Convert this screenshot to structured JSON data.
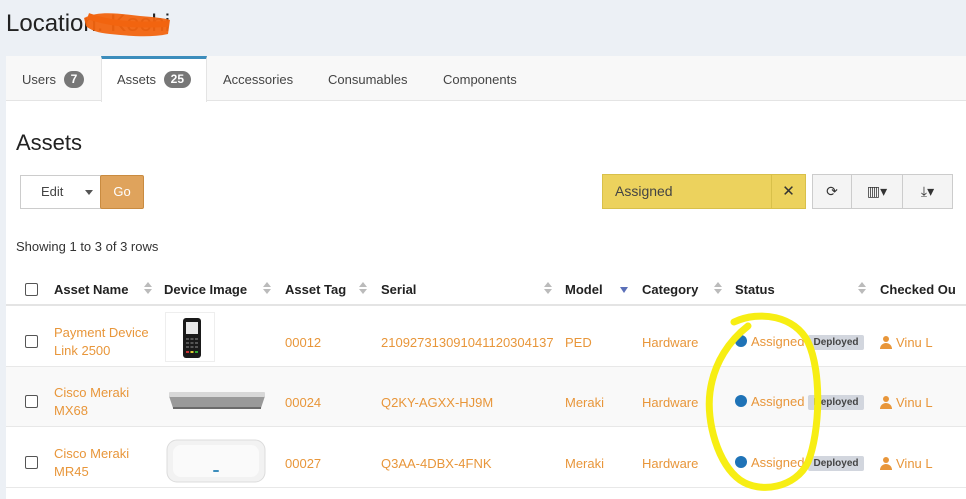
{
  "header": {
    "title": "Location: Kochi"
  },
  "tabs": [
    {
      "label": "Users",
      "count": "7"
    },
    {
      "label": "Assets",
      "count": "25"
    },
    {
      "label": "Accessories"
    },
    {
      "label": "Consumables"
    },
    {
      "label": "Components"
    }
  ],
  "section": {
    "title": "Assets"
  },
  "toolbar": {
    "bulk_action": "Edit",
    "go_label": "Go",
    "search_value": "Assigned",
    "clear_glyph": "✕",
    "refresh_glyph": "⟳",
    "columns_glyph": "▥▾",
    "export_glyph": "⤓▾"
  },
  "table": {
    "info": "Showing 1 to 3 of 3 rows",
    "columns": [
      "Asset Name",
      "Device Image",
      "Asset Tag",
      "Serial",
      "Model",
      "Category",
      "Status",
      "Checked Ou"
    ],
    "rows": [
      {
        "name": "Payment Device Link 2500",
        "tag": "00012",
        "serial": "2109273130910411203041​37",
        "model": "PED",
        "category": "Hardware",
        "status": "Assigned",
        "status_badge": "Deployed",
        "checked_out": "Vinu L",
        "image": "payment-terminal-icon"
      },
      {
        "name": "Cisco Meraki MX68",
        "tag": "00024",
        "serial": "Q2KY-AGXX-HJ9M",
        "model": "Meraki",
        "category": "Hardware",
        "status": "Assigned",
        "status_badge": "Deployed",
        "checked_out": "Vinu L",
        "image": "router-appliance-icon"
      },
      {
        "name": "Cisco Meraki MR45",
        "tag": "00027",
        "serial": "Q3AA-4DBX-4FNK",
        "model": "Meraki",
        "category": "Hardware",
        "status": "Assigned",
        "status_badge": "Deployed",
        "checked_out": "Vinu L",
        "image": "access-point-icon"
      }
    ]
  },
  "colors": {
    "accent": "#3c8dbc",
    "link": "#e8963a",
    "search_bg": "#ecd25d",
    "go_bg": "#dfa35c",
    "status_dot": "#1f73b7",
    "redaction": "#f2640f",
    "annotation": "#f7ee13"
  }
}
